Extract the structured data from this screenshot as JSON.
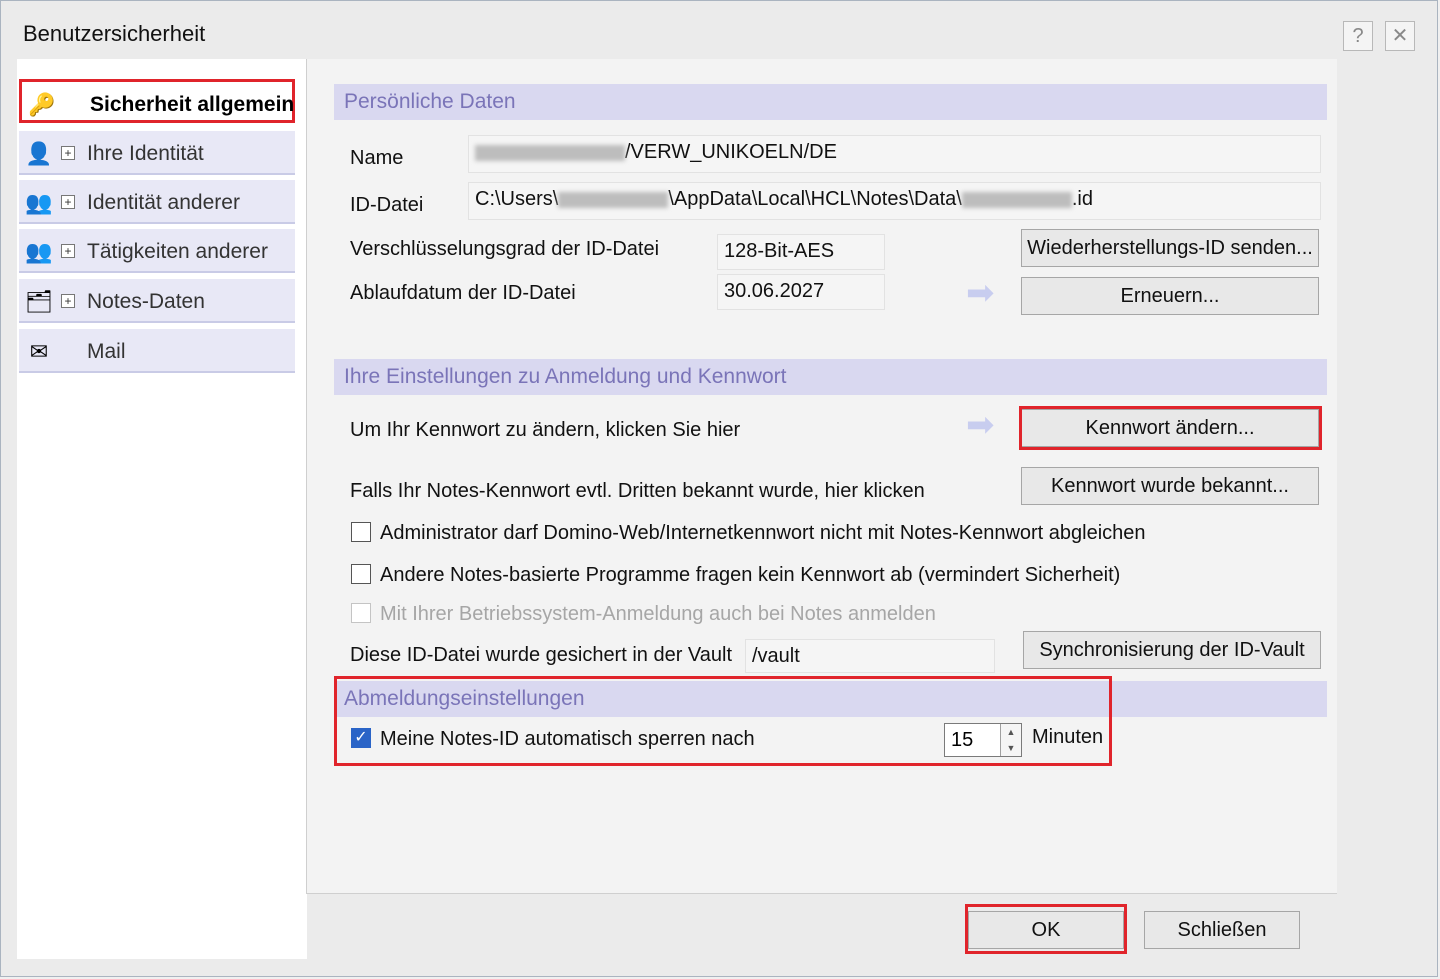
{
  "window": {
    "title": "Benutzersicherheit",
    "help_glyph": "?",
    "close_glyph": "✕"
  },
  "nav": {
    "items": [
      {
        "label": "Sicherheit allgemein",
        "icon": "key-icon",
        "glyph": "🔑",
        "expandable": false,
        "active": true
      },
      {
        "label": "Ihre Identität",
        "icon": "user-badge-icon",
        "glyph": "👤",
        "expandable": true,
        "active": false
      },
      {
        "label": "Identität anderer",
        "icon": "users-icon",
        "glyph": "👥",
        "expandable": true,
        "active": false
      },
      {
        "label": "Tätigkeiten anderer",
        "icon": "group-activity-icon",
        "glyph": "👥",
        "expandable": true,
        "active": false
      },
      {
        "label": "Notes-Daten",
        "icon": "database-stack-icon",
        "glyph": "🗂",
        "expandable": true,
        "active": false
      },
      {
        "label": "Mail",
        "icon": "mail-icon",
        "glyph": "✉",
        "expandable": false,
        "active": false
      }
    ],
    "expand_glyph": "+"
  },
  "personal": {
    "header": "Persönliche Daten",
    "name_label": "Name",
    "name_value": "/VERW_UNIKOELN/DE",
    "id_label": "ID-Datei",
    "id_prefix": "C:\\Users\\",
    "id_middle": "\\AppData\\Local\\HCL\\Notes\\Data\\",
    "id_suffix": ".id",
    "enc_label": "Verschlüsselungsgrad der ID-Datei",
    "enc_value": "128-Bit-AES",
    "expiry_label": "Ablaufdatum der ID-Datei",
    "expiry_value": "30.06.2027",
    "recovery_button": "Wiederherstellungs-ID senden...",
    "renew_button": "Erneuern..."
  },
  "login": {
    "header": "Ihre Einstellungen zu Anmeldung und Kennwort",
    "change_text": "Um Ihr Kennwort zu ändern, klicken Sie hier",
    "change_button": "Kennwort ändern...",
    "known_text": "Falls Ihr Notes-Kennwort evtl. Dritten bekannt wurde, hier klicken",
    "known_button": "Kennwort wurde bekannt...",
    "cb1_label": "Administrator darf Domino-Web/Internetkennwort nicht mit Notes-Kennwort abgleichen",
    "cb2_label": "Andere Notes-basierte Programme fragen kein Kennwort ab (vermindert Sicherheit)",
    "cb3_label": "Mit Ihrer Betriebssystem-Anmeldung auch bei Notes anmelden",
    "vault_label": "Diese ID-Datei wurde gesichert in der Vault",
    "vault_value": "/vault",
    "vault_button": "Synchronisierung der ID-Vault"
  },
  "logout": {
    "header": "Abmeldungseinstellungen",
    "lock_label": "Meine Notes-ID automatisch sperren nach",
    "lock_checked": true,
    "minutes_value": "15",
    "minutes_unit": "Minuten"
  },
  "footer": {
    "ok_button": "OK",
    "close_button": "Schließen"
  },
  "colors": {
    "highlight_red": "#e0242b",
    "section_bg": "#d9d8f0",
    "section_text": "#7a74b8",
    "checkbox_blue": "#2a64c7"
  }
}
